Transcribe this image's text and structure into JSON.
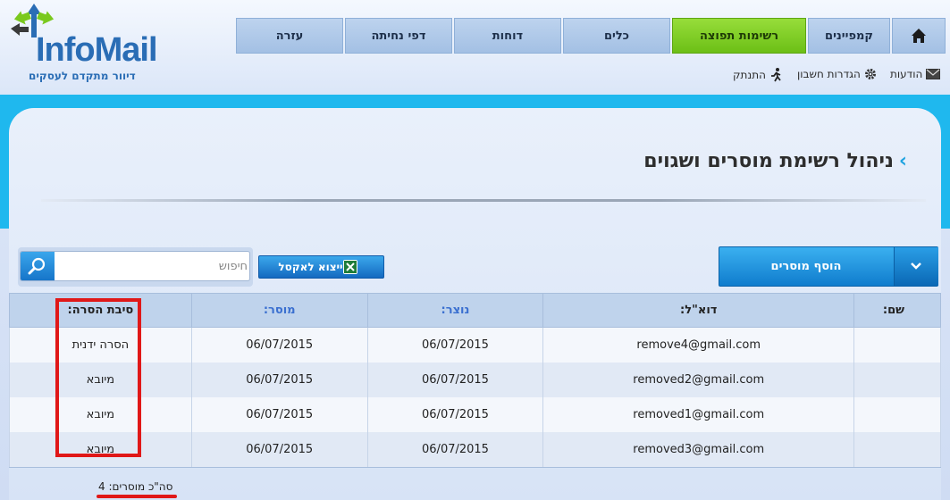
{
  "brand": {
    "name_part1": "Info",
    "name_part2": "Mail",
    "tagline": "דיוור מתקדם לעסקים"
  },
  "nav": {
    "items": [
      {
        "label": "עזרה",
        "active": false
      },
      {
        "label": "דפי נחיתה",
        "active": false
      },
      {
        "label": "דוחות",
        "active": false
      },
      {
        "label": "כלים",
        "active": false
      },
      {
        "label": "רשימות תפוצה",
        "active": true
      },
      {
        "label": "קמפיינים",
        "active": false
      }
    ],
    "home_icon": "home-icon"
  },
  "utils": {
    "logout": "התנתק",
    "settings": "הגדרות חשבון",
    "messages": "הודעות"
  },
  "page": {
    "title": "ניהול רשימת מוסרים ושגוים"
  },
  "toolbar": {
    "add_label": "הוסף מוסרים",
    "export_label": "ייצוא לאקסל",
    "search_placeholder": "חיפוש"
  },
  "table": {
    "headers": {
      "name": "שם:",
      "email": "דוא\"ל:",
      "created": "נוצר:",
      "removed": "מוסר:",
      "reason": "סיבת הסרה:"
    },
    "rows": [
      {
        "name": "",
        "email": "remove4@gmail.com",
        "created": "06/07/2015",
        "removed": "06/07/2015",
        "reason": "הסרה ידנית"
      },
      {
        "name": "",
        "email": "removed2@gmail.com",
        "created": "06/07/2015",
        "removed": "06/07/2015",
        "reason": "מיובא"
      },
      {
        "name": "",
        "email": "removed1@gmail.com",
        "created": "06/07/2015",
        "removed": "06/07/2015",
        "reason": "מיובא"
      },
      {
        "name": "",
        "email": "removed3@gmail.com",
        "created": "06/07/2015",
        "removed": "06/07/2015",
        "reason": "מיובא"
      }
    ]
  },
  "footer": {
    "total_text": "סה\"כ מוסרים: 4"
  },
  "colors": {
    "accent": "#1fb8ee",
    "active_tab": "#7ac91e",
    "highlight": "#e01818"
  }
}
